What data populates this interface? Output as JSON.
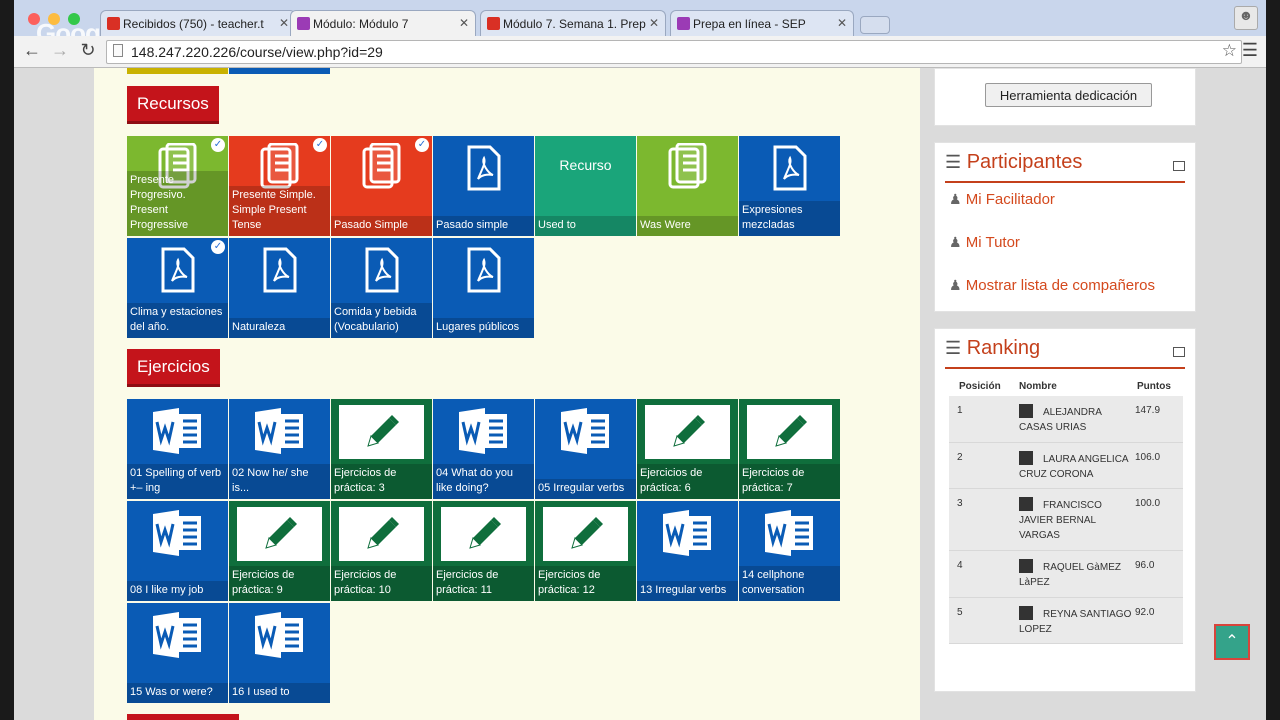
{
  "browser": {
    "tabs": [
      {
        "label": "Recibidos (750) - teacher.t",
        "icon": "gmail-icon",
        "color": "#d93025"
      },
      {
        "label": "Módulo: Módulo 7",
        "icon": "moodle-icon",
        "color": "#9b3bb5"
      },
      {
        "label": "Módulo 7. Semana 1. Prep",
        "icon": "google-plus-icon",
        "color": "#d93025"
      },
      {
        "label": "Prepa en línea - SEP",
        "icon": "moodle-icon",
        "color": "#9b3bb5"
      }
    ],
    "url": "148.247.220.226/course/view.php?id=29",
    "watermark": "Google"
  },
  "sections": {
    "recursos": "Recursos",
    "ejercicios": "Ejercicios"
  },
  "recursos_tiles": [
    {
      "label": "Presente Progresivo. Present Progressive",
      "icon": "document-icon",
      "color": "#7cb82f",
      "checked": true
    },
    {
      "label": "Presente Simple. Simple Present Tense",
      "icon": "document-icon",
      "color": "#e53b1e",
      "checked": true
    },
    {
      "label": "Pasado Simple",
      "icon": "document-icon",
      "color": "#e53b1e",
      "checked": true
    },
    {
      "label": "Pasado simple",
      "icon": "pdf-icon",
      "color": "#0a5bb5",
      "checked": false
    },
    {
      "label": "Used to",
      "icon": "recurso-text",
      "icon_text": "Recurso",
      "color": "#1aa57a",
      "checked": false
    },
    {
      "label": "Was Were",
      "icon": "document-icon",
      "color": "#7cb82f",
      "checked": false
    },
    {
      "label": "Expresiones mezcladas",
      "icon": "pdf-icon",
      "color": "#0a5bb5",
      "checked": false
    },
    {
      "label": "Clima y estaciones del año.",
      "icon": "pdf-icon",
      "color": "#0a5bb5",
      "checked": true
    },
    {
      "label": "Naturaleza",
      "icon": "pdf-icon",
      "color": "#0a5bb5",
      "checked": false
    },
    {
      "label": "Comida y bebida (Vocabulario)",
      "icon": "pdf-icon",
      "color": "#0a5bb5",
      "checked": false
    },
    {
      "label": "Lugares públicos",
      "icon": "pdf-icon",
      "color": "#0a5bb5",
      "checked": false
    }
  ],
  "ejercicios_tiles": [
    {
      "label": "01 Spelling of verb +– ing",
      "icon": "word-icon",
      "color": "#0a5bb5"
    },
    {
      "label": "02 Now he/ she is...",
      "icon": "word-icon",
      "color": "#0a5bb5"
    },
    {
      "label": "Ejercicios de práctica: 3",
      "icon": "pencil-icon",
      "color": "#0f6e3c"
    },
    {
      "label": "04 What do you like doing?",
      "icon": "word-icon",
      "color": "#0a5bb5"
    },
    {
      "label": "05 Irregular verbs",
      "icon": "word-icon",
      "color": "#0a5bb5"
    },
    {
      "label": "Ejercicios de práctica: 6",
      "icon": "pencil-icon",
      "color": "#0f6e3c"
    },
    {
      "label": "Ejercicios de práctica: 7",
      "icon": "pencil-icon",
      "color": "#0f6e3c"
    },
    {
      "label": "08 I like my job",
      "icon": "word-icon",
      "color": "#0a5bb5"
    },
    {
      "label": "Ejercicios de práctica: 9",
      "icon": "pencil-icon",
      "color": "#0f6e3c"
    },
    {
      "label": "Ejercicios de práctica: 10",
      "icon": "pencil-icon",
      "color": "#0f6e3c"
    },
    {
      "label": "Ejercicios de práctica: 11",
      "icon": "pencil-icon",
      "color": "#0f6e3c"
    },
    {
      "label": "Ejercicios de práctica: 12",
      "icon": "pencil-icon",
      "color": "#0f6e3c"
    },
    {
      "label": "13 Irregular verbs",
      "icon": "word-icon",
      "color": "#0a5bb5"
    },
    {
      "label": "14 cellphone conversation",
      "icon": "word-icon",
      "color": "#0a5bb5"
    },
    {
      "label": "15 Was or were?",
      "icon": "word-icon",
      "color": "#0a5bb5"
    },
    {
      "label": "16 I used to",
      "icon": "word-icon",
      "color": "#0a5bb5"
    }
  ],
  "sidebar": {
    "dedicacion_button": "Herramienta dedicación",
    "participantes": {
      "title": "Participantes",
      "links": [
        "Mi Facilitador",
        "Mi Tutor",
        "Mostrar lista de compañeros"
      ]
    },
    "ranking": {
      "title": "Ranking",
      "headers": {
        "pos": "Posición",
        "name": "Nombre",
        "pts": "Puntos"
      },
      "rows": [
        {
          "pos": "1",
          "name": "ALEJANDRA CASAS URIAS",
          "pts": "147.9"
        },
        {
          "pos": "2",
          "name": "LAURA ANGELICA CRUZ CORONA",
          "pts": "106.0"
        },
        {
          "pos": "3",
          "name": "FRANCISCO JAVIER BERNAL VARGAS",
          "pts": "100.0"
        },
        {
          "pos": "4",
          "name": "RAQUEL GàMEZ LàPEZ",
          "pts": "96.0"
        },
        {
          "pos": "5",
          "name": "REYNA SANTIAGO LOPEZ",
          "pts": "92.0"
        }
      ]
    }
  },
  "colors": {
    "accent": "#c4401b",
    "section": "#c4141b"
  }
}
